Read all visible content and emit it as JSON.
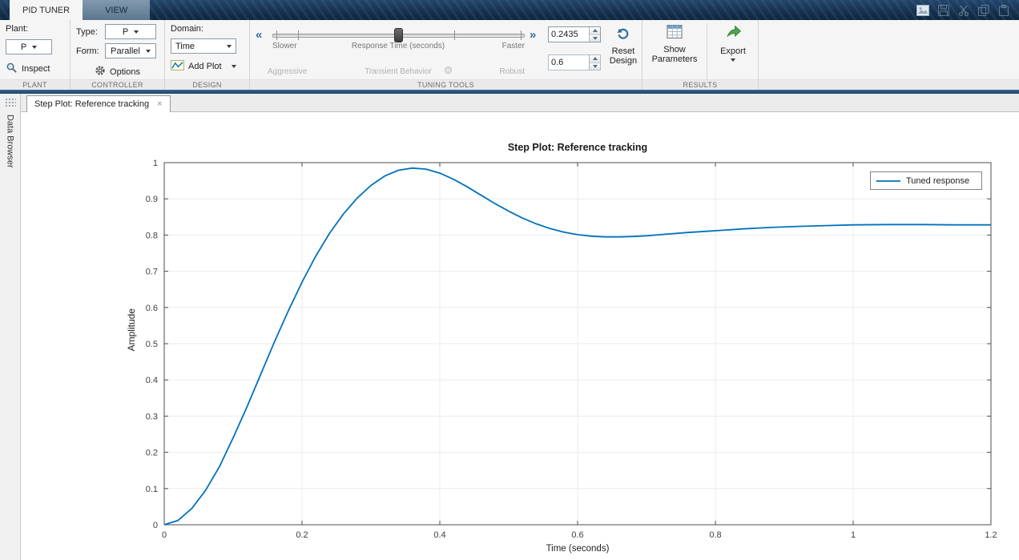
{
  "titlebar": {
    "tabs": [
      {
        "label": "PID TUNER"
      },
      {
        "label": "VIEW"
      }
    ]
  },
  "icons": {
    "chevron_left": "«",
    "chevron_right": "»",
    "close": "×"
  },
  "ribbon": {
    "plant": {
      "label": "Plant:",
      "value": "P",
      "inspect": "Inspect",
      "section": "PLANT"
    },
    "controller": {
      "type_label": "Type:",
      "type_value": "P",
      "form_label": "Form:",
      "form_value": "Parallel",
      "options": "Options",
      "section": "CONTROLLER"
    },
    "design": {
      "domain_label": "Domain:",
      "domain_value": "Time",
      "add_plot": "Add Plot",
      "section": "DESIGN"
    },
    "tuning": {
      "slower": "Slower",
      "response_time": "Response Time (seconds)",
      "faster": "Faster",
      "aggressive": "Aggressive",
      "transient": "Transient Behavior",
      "robust": "Robust",
      "response_time_value": "0.2435",
      "transient_value": "0.6",
      "reset_design": "Reset Design",
      "section": "TUNING TOOLS"
    },
    "results": {
      "show_parameters": "Show Parameters",
      "export": "Export",
      "section": "RESULTS"
    }
  },
  "sidebar": {
    "label": "Data Browser"
  },
  "document": {
    "tab_label": "Step Plot: Reference tracking"
  },
  "chart_data": {
    "type": "line",
    "title": "Step Plot: Reference tracking",
    "xlabel": "Time (seconds)",
    "ylabel": "Amplitude",
    "xlim": [
      0,
      1.2
    ],
    "ylim": [
      0,
      1
    ],
    "xticks": [
      0,
      0.2,
      0.4,
      0.6,
      0.8,
      1,
      1.2
    ],
    "xtick_labels": [
      "0",
      "0.2",
      "0.4",
      "0.6",
      "0.8",
      "1",
      "1.2"
    ],
    "yticks": [
      0,
      0.1,
      0.2,
      0.3,
      0.4,
      0.5,
      0.6,
      0.7,
      0.8,
      0.9,
      1
    ],
    "ytick_labels": [
      "0",
      "0.1",
      "0.2",
      "0.3",
      "0.4",
      "0.5",
      "0.6",
      "0.7",
      "0.8",
      "0.9",
      "1"
    ],
    "grid": true,
    "grid_color": "#ebebeb",
    "legend_position": "top-right",
    "series": [
      {
        "name": "Tuned response",
        "color": "#0072bd",
        "x": [
          0,
          0.02,
          0.04,
          0.06,
          0.08,
          0.1,
          0.12,
          0.14,
          0.16,
          0.18,
          0.2,
          0.22,
          0.24,
          0.26,
          0.28,
          0.3,
          0.32,
          0.34,
          0.36,
          0.38,
          0.4,
          0.42,
          0.44,
          0.46,
          0.48,
          0.5,
          0.52,
          0.54,
          0.56,
          0.58,
          0.6,
          0.62,
          0.64,
          0.66,
          0.68,
          0.7,
          0.72,
          0.76,
          0.8,
          0.84,
          0.88,
          0.92,
          0.96,
          1,
          1.05,
          1.1,
          1.15,
          1.2
        ],
        "y": [
          0,
          0.012,
          0.045,
          0.095,
          0.16,
          0.24,
          0.325,
          0.415,
          0.505,
          0.59,
          0.67,
          0.742,
          0.805,
          0.858,
          0.902,
          0.937,
          0.963,
          0.979,
          0.985,
          0.982,
          0.971,
          0.954,
          0.933,
          0.91,
          0.887,
          0.866,
          0.847,
          0.831,
          0.818,
          0.808,
          0.801,
          0.797,
          0.795,
          0.795,
          0.796,
          0.798,
          0.801,
          0.807,
          0.812,
          0.817,
          0.821,
          0.824,
          0.826,
          0.828,
          0.829,
          0.829,
          0.828,
          0.828
        ]
      }
    ]
  }
}
